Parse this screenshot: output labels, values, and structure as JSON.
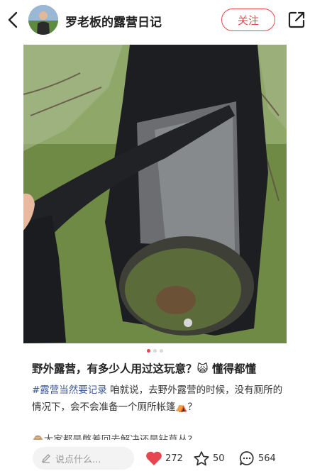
{
  "header": {
    "author_name": "罗老板的露营日记",
    "follow_label": "关注"
  },
  "post": {
    "title": "野外露营，有多少人用过这玩意？🙀 懂得都懂",
    "hashtag": "#露营当然要记录",
    "body": "咱就说，去野外露营的时候，没有厕所的情况下，会不会准备一个厕所帐篷⛺？",
    "next_line": "🙈大家都是憋着回去解决还是钻草丛?"
  },
  "carousel": {
    "total": 3,
    "active": 1
  },
  "bottom_bar": {
    "comment_placeholder": "说点什么...",
    "likes": "272",
    "stars": "50",
    "comments": "564"
  },
  "colors": {
    "accent": "#e8464f",
    "tag": "#3b5998"
  },
  "icons": [
    "back-icon",
    "share-icon",
    "pencil-icon",
    "heart-icon",
    "star-icon",
    "comment-icon"
  ]
}
